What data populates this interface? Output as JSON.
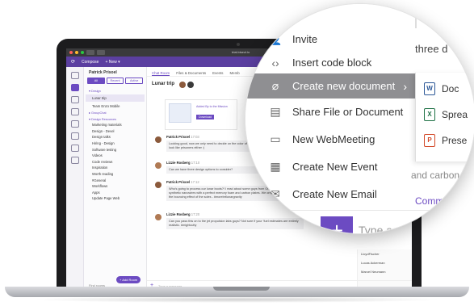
{
  "browser": {
    "url": "trial.bisect.io"
  },
  "toolbar": {
    "compose": "Compose",
    "new": "+ New ▾"
  },
  "sidebar": {
    "user": "Patrick Prisoel",
    "filters": [
      {
        "label": "All",
        "active": true
      },
      {
        "label": "Recent",
        "active": false
      },
      {
        "label": "Active",
        "active": false
      }
    ],
    "group1": "▾ Design",
    "items1": [
      "Lunar trip",
      "Team Enzo Mobile"
    ],
    "group2": "▸ GroupChat",
    "group3": "▾ Design Resources",
    "items3": [
      "Marketing materials",
      "Design - Devel",
      "Design talks",
      "Hiring - Design",
      "Software testing",
      "Videos",
      "Code reviews",
      "Inspiration",
      "Worth reading",
      "#General",
      "Workflows",
      "Apps",
      "Update Page Web"
    ],
    "add_room": "+ Add Room",
    "find": "Find rooms"
  },
  "main": {
    "tabs": [
      {
        "label": "Chat Room",
        "active": true
      },
      {
        "label": "Files & Documents",
        "active": false
      },
      {
        "label": "Events",
        "active": false
      },
      {
        "label": "Memb",
        "active": false
      }
    ],
    "title": "Lunar trip",
    "card": {
      "title": "Added By to the Mission",
      "download": "Download"
    },
    "messages": [
      {
        "who": "Patrick Prisoel",
        "time": "17:03",
        "text": "Looking good, now we only need to decide on the color of s... But we don't want the explorers to look like prisoners either :)"
      },
      {
        "who": "Lizzie Rosberg",
        "time": "17:10",
        "text": "Can we have three design options to consider?"
      },
      {
        "who": "Patrick Prisoel",
        "time": "17:12",
        "text": "Who's going to process our lunar boots?! I read about some guys from Oregon who designed synthetic nanowires with a perfect memory foam and carbon plates. We only need to make sure the bouncing effect of the soles - #morebrtlunargravity"
      },
      {
        "who": "Lizzie Rosberg",
        "time": "17:20",
        "text": "Can you pass this on to the jet propulsion labs guys? Not sure if your 'fuel estimates are entirely realistic. #mightcutty"
      }
    ],
    "compose_placeholder": "Type a message",
    "members": [
      "LloydFischer",
      "Lucas Ackerman",
      "Marcel Neumann"
    ]
  },
  "lens": {
    "menu": [
      {
        "icon": "👤",
        "label": "Invite"
      },
      {
        "icon": "‹›",
        "label": "Insert code block"
      },
      {
        "icon": "⌀",
        "label": "Create new document",
        "highlight": true
      },
      {
        "icon": "▤",
        "label": "Share File or Document"
      },
      {
        "icon": "▭",
        "label": "New WebMeeting"
      },
      {
        "icon": "▦",
        "label": "Create New Event"
      },
      {
        "icon": "✉",
        "label": "Create New Email"
      }
    ],
    "submenu": [
      {
        "badge": "W",
        "color": "#2b5797",
        "label": "Doc"
      },
      {
        "badge": "X",
        "color": "#1e7145",
        "label": "Sprea"
      },
      {
        "badge": "P",
        "color": "#d24726",
        "label": "Prese"
      }
    ],
    "bg_text1": "three d",
    "bg_text2": "and carbon",
    "bg_text3": "Comments",
    "type_message": "Type a messa"
  }
}
